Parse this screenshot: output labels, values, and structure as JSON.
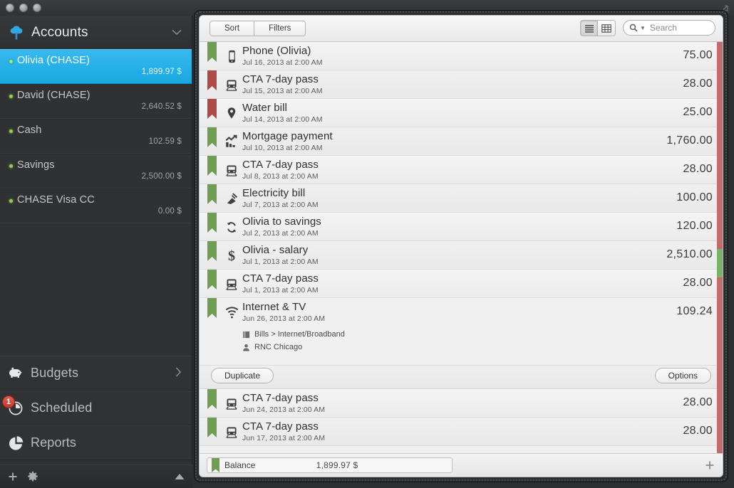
{
  "window": {
    "traffic_lights": [
      "close",
      "minimize",
      "zoom"
    ],
    "resize_icon": "resize-expand-icon"
  },
  "sidebar": {
    "header": {
      "title": "Accounts",
      "icon": "tree-icon",
      "chevron": "chevron-down-icon"
    },
    "accounts": [
      {
        "name": "Olivia (CHASE)",
        "balance": "1,899.97 $",
        "selected": true,
        "status": "active"
      },
      {
        "name": "David (CHASE)",
        "balance": "2,640.52 $",
        "selected": false,
        "status": "active"
      },
      {
        "name": "Cash",
        "balance": "102.59 $",
        "selected": false,
        "status": "active"
      },
      {
        "name": "Savings",
        "balance": "2,500.00 $",
        "selected": false,
        "status": "active"
      },
      {
        "name": "CHASE Visa CC",
        "balance": "0.00 $",
        "selected": false,
        "status": "active"
      }
    ],
    "nav": [
      {
        "label": "Budgets",
        "icon": "piggy-bank-icon",
        "caret": "chevron-right-icon",
        "badge": ""
      },
      {
        "label": "Scheduled",
        "icon": "clock-icon",
        "caret": "",
        "badge": "1"
      },
      {
        "label": "Reports",
        "icon": "pie-chart-icon",
        "caret": "",
        "badge": ""
      }
    ],
    "footer": {
      "add_label": "+",
      "settings_icon": "gear-icon",
      "collapse_icon": "triangle-up-icon"
    }
  },
  "toolbar": {
    "sort_label": "Sort",
    "filters_label": "Filters",
    "view_list_icon": "list-view-icon",
    "view_grid_icon": "grid-view-icon",
    "active_view": "list",
    "search": {
      "placeholder": "Search",
      "value": "",
      "icon": "search-icon",
      "caret": "caret-down-icon"
    }
  },
  "transactions": [
    {
      "name": "Phone (Olivia)",
      "date": "Jul 16, 2013 at 2:00 AM",
      "amount": "75.00",
      "flag": "green",
      "icon": "phone-icon",
      "expanded": false
    },
    {
      "name": "CTA 7-day pass",
      "date": "Jul 15, 2013 at 2:00 AM",
      "amount": "28.00",
      "flag": "red",
      "icon": "train-icon",
      "expanded": false
    },
    {
      "name": "Water bill",
      "date": "Jul 14, 2013 at 2:00 AM",
      "amount": "25.00",
      "flag": "red",
      "icon": "pin-icon",
      "expanded": false
    },
    {
      "name": "Mortgage payment",
      "date": "Jul 10, 2013 at 2:00 AM",
      "amount": "1,760.00",
      "flag": "green",
      "icon": "chart-icon",
      "expanded": false
    },
    {
      "name": "CTA 7-day pass",
      "date": "Jul 8, 2013 at 2:00 AM",
      "amount": "28.00",
      "flag": "green",
      "icon": "train-icon",
      "expanded": false
    },
    {
      "name": "Electricity bill",
      "date": "Jul 7, 2013 at 2:00 AM",
      "amount": "100.00",
      "flag": "green",
      "icon": "plug-icon",
      "expanded": false
    },
    {
      "name": "Olivia to savings",
      "date": "Jul 2, 2013 at 2:00 AM",
      "amount": "120.00",
      "flag": "green",
      "icon": "transfer-icon",
      "expanded": false
    },
    {
      "name": "Olivia - salary",
      "date": "Jul 1, 2013 at 2:00 AM",
      "amount": "2,510.00",
      "flag": "green",
      "icon": "dollar-icon",
      "expanded": false
    },
    {
      "name": "CTA 7-day pass",
      "date": "Jul 1, 2013 at 2:00 AM",
      "amount": "28.00",
      "flag": "green",
      "icon": "train-icon",
      "expanded": false
    },
    {
      "name": "Internet & TV",
      "date": "Jun 26, 2013 at 2:00 AM",
      "amount": "109.24",
      "flag": "green",
      "icon": "wifi-icon",
      "expanded": true,
      "category": "Bills > Internet/Broadband",
      "category_icon": "book-icon",
      "payee": "RNC Chicago",
      "payee_icon": "person-icon"
    },
    {
      "name": "CTA 7-day pass",
      "date": "Jun 24, 2013 at 2:00 AM",
      "amount": "28.00",
      "flag": "green",
      "icon": "train-icon",
      "expanded": false
    },
    {
      "name": "CTA 7-day pass",
      "date": "Jun 17, 2013 at 2:00 AM",
      "amount": "28.00",
      "flag": "green",
      "icon": "train-icon",
      "expanded": false
    }
  ],
  "actions": {
    "duplicate_label": "Duplicate",
    "options_label": "Options"
  },
  "statusbar": {
    "balance_label": "Balance",
    "balance_value": "1,899.97 $",
    "add_icon": "plus-icon",
    "flag_icon": "bookmark-green-icon"
  },
  "colors": {
    "accent_blue": "#1ea9e3",
    "flag_green": "#6f9e52",
    "flag_red": "#b04a47",
    "badge_red": "#cc4034",
    "status_dot": "#8fd14f",
    "edge_expense": "#c46a6a",
    "edge_income": "#79b濃"
  }
}
